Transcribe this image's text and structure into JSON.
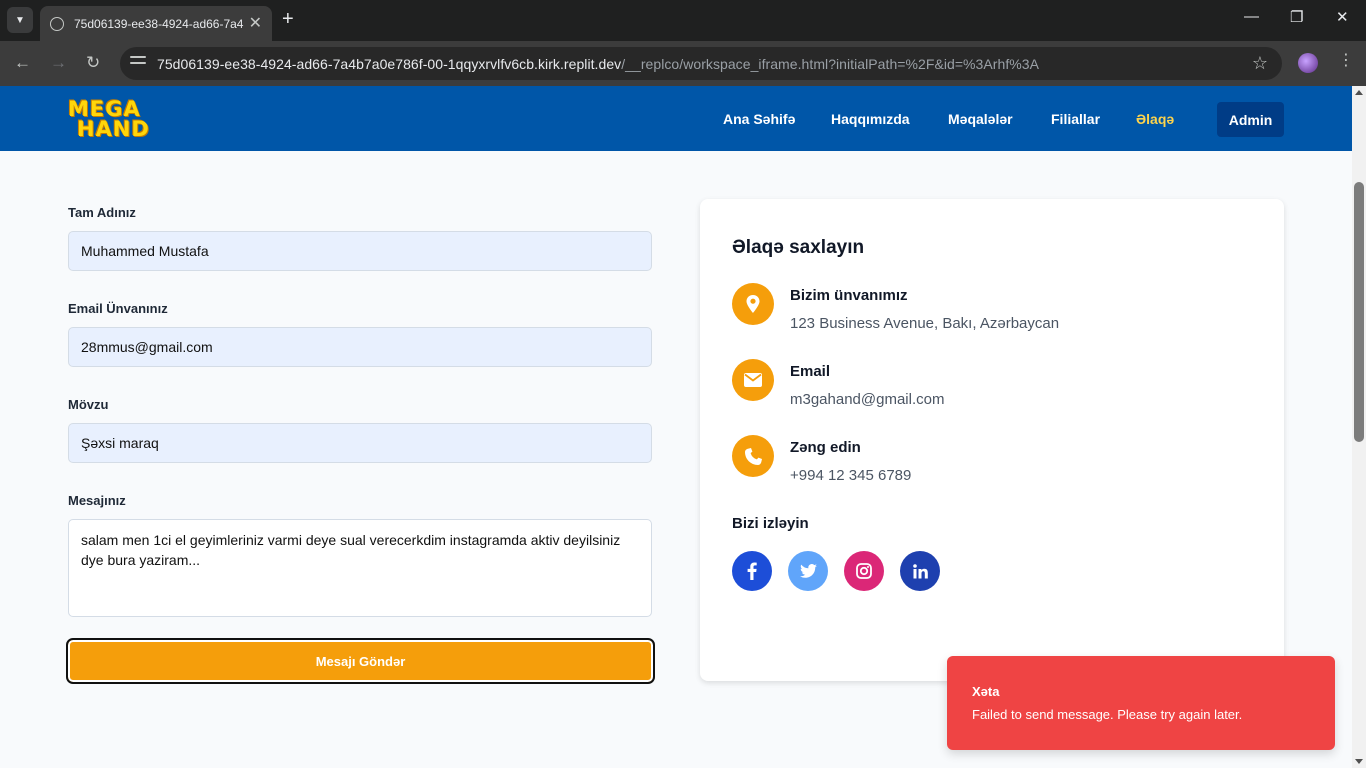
{
  "browser": {
    "tab_title": "75d06139-ee38-4924-ad66-7a4",
    "url_main": "75d06139-ee38-4924-ad66-7a4b7a0e786f-00-1qqyxrvlfv6cb.kirk.replit.dev",
    "url_path": "/__replco/workspace_iframe.html?initialPath=%2F&id=%3Arhf%3A"
  },
  "header": {
    "logo_line1": "MEGA",
    "logo_line2": "HAND",
    "nav": [
      "Ana Səhifə",
      "Haqqımızda",
      "Məqalələr",
      "Filiallar",
      "Əlaqə"
    ],
    "active_nav": "Əlaqə",
    "admin_label": "Admin"
  },
  "form": {
    "name_label": "Tam Adınız",
    "name_value": "Muhammed Mustafa",
    "email_label": "Email Ünvanınız",
    "email_value": "28mmus@gmail.com",
    "subject_label": "Mövzu",
    "subject_value": "Şəxsi maraq",
    "message_label": "Mesajınız",
    "message_value": "salam men 1ci el geyimleriniz varmi deye sual verecerkdim instagramda aktiv deyilsiniz dye bura yaziram...",
    "submit_label": "Mesajı Göndər"
  },
  "contact": {
    "title": "Əlaqə saxlayın",
    "items": [
      {
        "title": "Bizim ünvanımız",
        "value": "123 Business Avenue, Bakı, Azərbaycan",
        "icon": "map-pin-icon"
      },
      {
        "title": "Email",
        "value": "m3gahand@gmail.com",
        "icon": "envelope-icon"
      },
      {
        "title": "Zəng edin",
        "value": "+994 12 345 6789",
        "icon": "phone-icon"
      }
    ],
    "follow_title": "Bizi izləyin",
    "socials": [
      {
        "name": "facebook",
        "color": "#1d4ed8"
      },
      {
        "name": "twitter",
        "color": "#60a5fa"
      },
      {
        "name": "instagram",
        "color": "#db2777"
      },
      {
        "name": "linkedin",
        "color": "#1e40af"
      }
    ]
  },
  "toast": {
    "title": "Xəta",
    "message": "Failed to send message. Please try again later.",
    "color": "#ef4444"
  },
  "colors": {
    "header_bg": "#0056a8",
    "accent": "#f59e0b",
    "active_nav": "#fcd34d"
  }
}
